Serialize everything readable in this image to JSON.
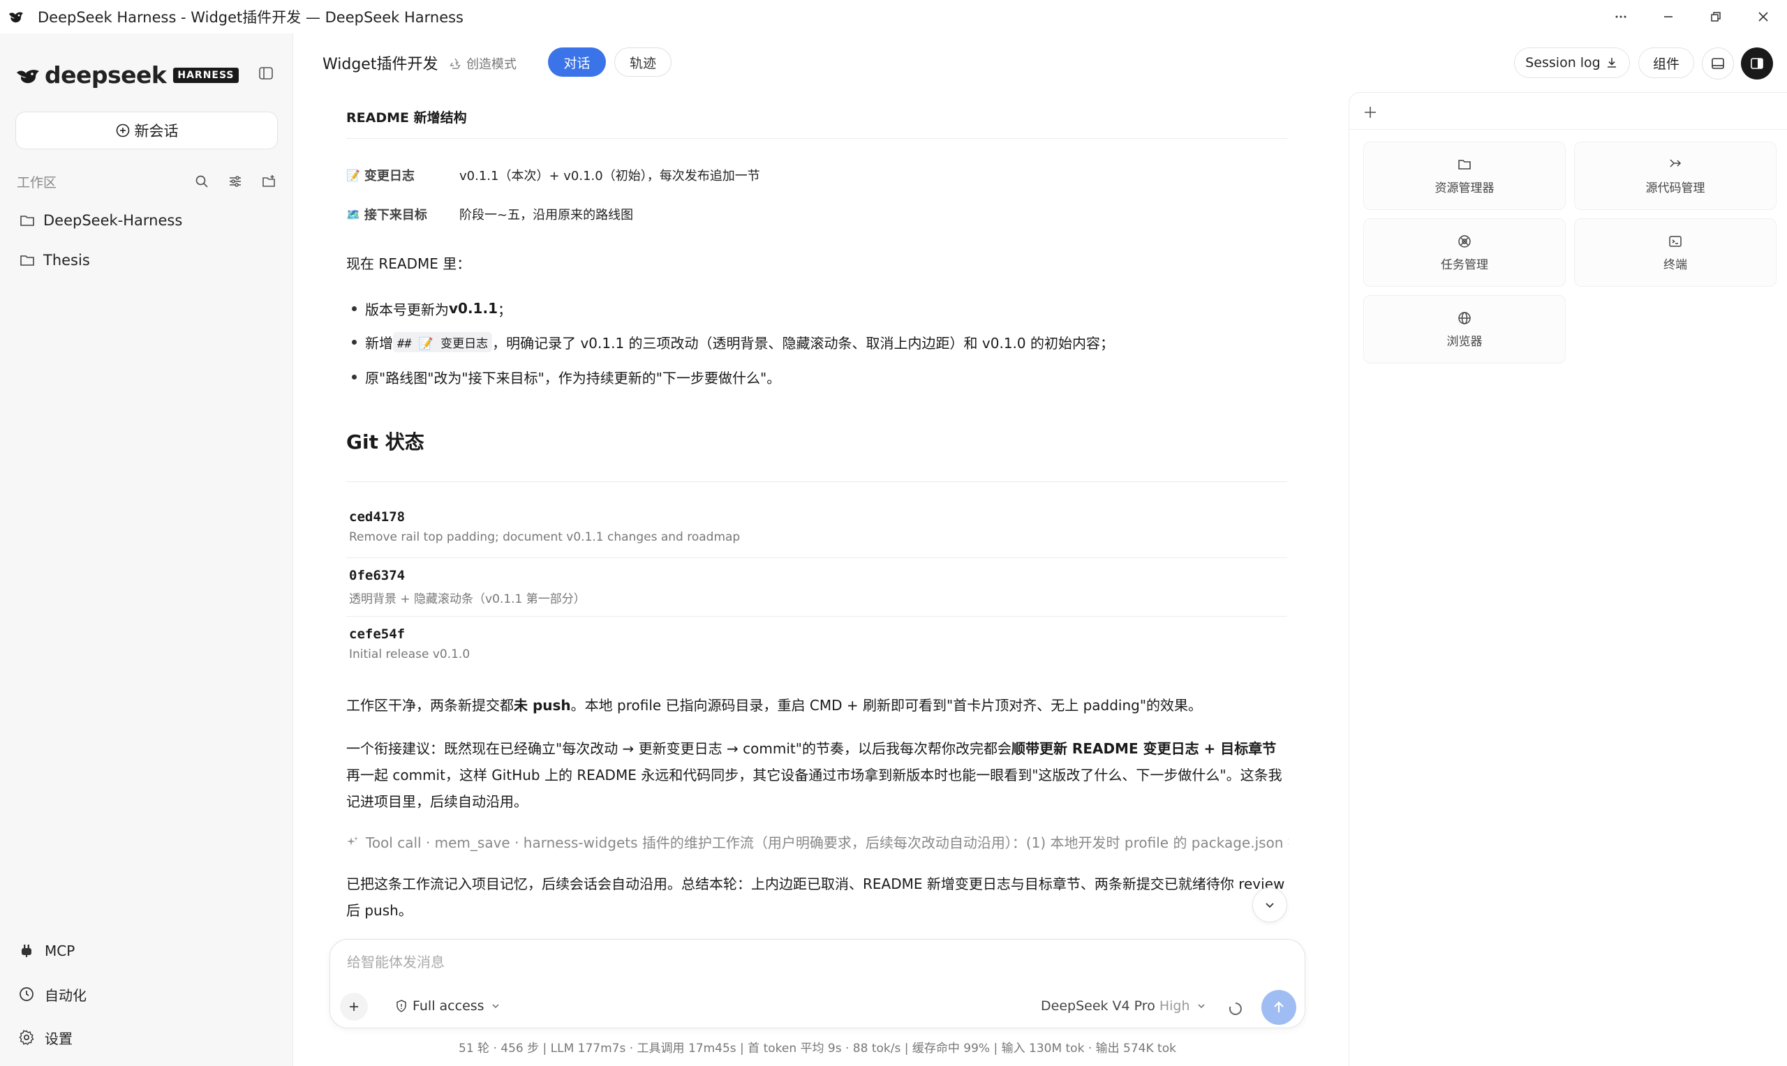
{
  "window": {
    "title": "DeepSeek Harness - Widget插件开发 — DeepSeek Harness"
  },
  "sidebar": {
    "brand_text": "deepseek",
    "brand_badge": "HARNESS",
    "new_chat_label": "新会话",
    "workspace_label": "工作区",
    "folders": [
      {
        "label": "DeepSeek-Harness"
      },
      {
        "label": "Thesis"
      }
    ],
    "bottom_items": [
      {
        "label": "MCP"
      },
      {
        "label": "自动化"
      },
      {
        "label": "设置"
      }
    ]
  },
  "header": {
    "project_title": "Widget插件开发",
    "mode_label": "创造模式",
    "tabs": [
      {
        "label": "对话",
        "active": true
      },
      {
        "label": "轨迹",
        "active": false
      }
    ],
    "session_log_label": "Session log",
    "components_label": "组件"
  },
  "content": {
    "readme_heading": "README 新增结构",
    "table": [
      {
        "emoji": "📝",
        "key": "变更日志",
        "value": "v0.1.1（本次）+ v0.1.0（初始），每次发布追加一节"
      },
      {
        "emoji": "🗺️",
        "key": "接下来目标",
        "value": "阶段一~五，沿用原来的路线图"
      }
    ],
    "now_readme": "现在 README 里：",
    "bullets": {
      "b1_pre": "版本号更新为 ",
      "b1_bold": "v0.1.1",
      "b1_post": "；",
      "b2_pre": "新增 ",
      "b2_code": "## 📝 变更日志",
      "b2_post": "，明确记录了 v0.1.1 的三项改动（透明背景、隐藏滚动条、取消上内边距）和 v0.1.0 的初始内容；",
      "b3": "原\"路线图\"改为\"接下来目标\"，作为持续更新的\"下一步要做什么\"。"
    },
    "git_heading": "Git 状态",
    "commits": [
      {
        "hash": "ced4178",
        "message": "Remove rail top padding; document v0.1.1 changes and roadmap"
      },
      {
        "hash": "0fe6374",
        "message": "透明背景 + 隐藏滚动条（v0.1.1 第一部分）"
      },
      {
        "hash": "cefe54f",
        "message": "Initial release v0.1.0"
      }
    ],
    "p1_pre": "工作区干净，两条新提交都",
    "p1_bold": "未 push",
    "p1_post": "。本地 profile 已指向源码目录，重启 CMD + 刷新即可看到\"首卡片顶对齐、无上 padding\"的效果。",
    "p2_pre": "一个衔接建议：既然现在已经确立\"每次改动 → 更新变更日志 → commit\"的节奏，以后我每次帮你改完都会",
    "p2_bold": "顺带更新 README 变更日志 + 目标章节",
    "p2_post": "再一起 commit，这样 GitHub 上的 README 永远和代码同步，其它设备通过市场拿到新版本时也能一眼看到\"这版改了什么、下一步做什么\"。这条我记进项目里，后续自动沿用。",
    "tool_call": "Tool call · mem_save · harness-widgets 插件的维护工作流（用户明确要求，后续每次改动自动沿用）：(1) 本地开发时 profile 的 package.json 指向源码目录…",
    "p3": "已把这条工作流记入项目记忆，后续会话会自动沿用。总结本轮：上内边距已取消、README 新增变更日志与目标章节、两条新提交已就绪待你 review 后 push。"
  },
  "composer": {
    "placeholder": "给智能体发消息",
    "access_label": "Full access",
    "model_label": "DeepSeek V4 Pro",
    "level_label": "High"
  },
  "stats": "51 轮 · 456 步  |  LLM 177m7s · 工具调用 17m45s  |  首 token 平均 9s · 88 tok/s  |  缓存命中 99%  |  输入 130M tok · 输出 574K tok",
  "right_panel": {
    "tools": [
      {
        "label": "资源管理器",
        "icon": "folder-icon"
      },
      {
        "label": "源代码管理",
        "icon": "git-branch-icon"
      },
      {
        "label": "任务管理",
        "icon": "task-icon"
      },
      {
        "label": "终端",
        "icon": "terminal-icon"
      },
      {
        "label": "浏览器",
        "icon": "globe-icon"
      }
    ]
  },
  "colors": {
    "accent": "#3b74e8",
    "send_button": "#9fbdf3",
    "sidebar_bg": "#f7f7f8"
  }
}
